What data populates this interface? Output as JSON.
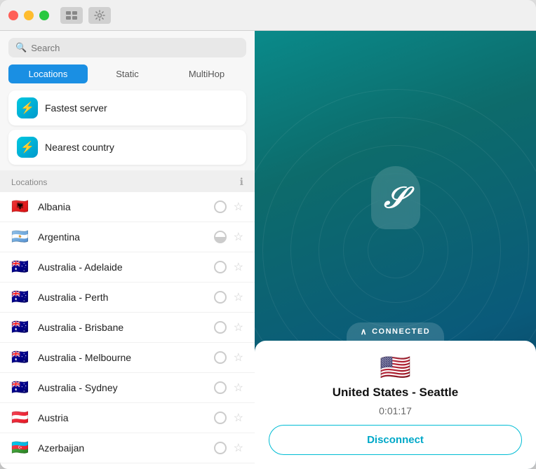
{
  "titleBar": {
    "buttons": [
      "close",
      "minimize",
      "maximize"
    ],
    "icons": [
      "window-icon",
      "settings-icon"
    ]
  },
  "leftPanel": {
    "search": {
      "placeholder": "Search"
    },
    "tabs": [
      {
        "id": "locations",
        "label": "Locations",
        "active": true
      },
      {
        "id": "static",
        "label": "Static",
        "active": false
      },
      {
        "id": "multihop",
        "label": "MultiHop",
        "active": false
      }
    ],
    "quickActions": [
      {
        "id": "fastest-server",
        "label": "Fastest server"
      },
      {
        "id": "nearest-country",
        "label": "Nearest country"
      }
    ],
    "sectionHeader": "Locations",
    "countries": [
      {
        "id": "albania",
        "flag": "🇦🇱",
        "name": "Albania",
        "radioState": "empty",
        "starred": false
      },
      {
        "id": "argentina",
        "flag": "🇦🇷",
        "name": "Argentina",
        "radioState": "half",
        "starred": false
      },
      {
        "id": "australia-adelaide",
        "flag": "🇦🇺",
        "name": "Australia - Adelaide",
        "radioState": "empty",
        "starred": false
      },
      {
        "id": "australia-perth",
        "flag": "🇦🇺",
        "name": "Australia - Perth",
        "radioState": "empty",
        "starred": false
      },
      {
        "id": "australia-brisbane",
        "flag": "🇦🇺",
        "name": "Australia - Brisbane",
        "radioState": "empty",
        "starred": false
      },
      {
        "id": "australia-melbourne",
        "flag": "🇦🇺",
        "name": "Australia - Melbourne",
        "radioState": "empty",
        "starred": false
      },
      {
        "id": "australia-sydney",
        "flag": "🇦🇺",
        "name": "Australia - Sydney",
        "radioState": "empty",
        "starred": false
      },
      {
        "id": "austria",
        "flag": "🇦🇹",
        "name": "Austria",
        "radioState": "empty",
        "starred": false
      },
      {
        "id": "azerbaijan",
        "flag": "🇦🇿",
        "name": "Azerbaijan",
        "radioState": "empty",
        "starred": false
      }
    ]
  },
  "rightPanel": {
    "status": "CONNECTED",
    "connection": {
      "flag": "🇺🇸",
      "location": "United States - Seattle",
      "timer": "0:01:17",
      "disconnectLabel": "Disconnect"
    }
  }
}
